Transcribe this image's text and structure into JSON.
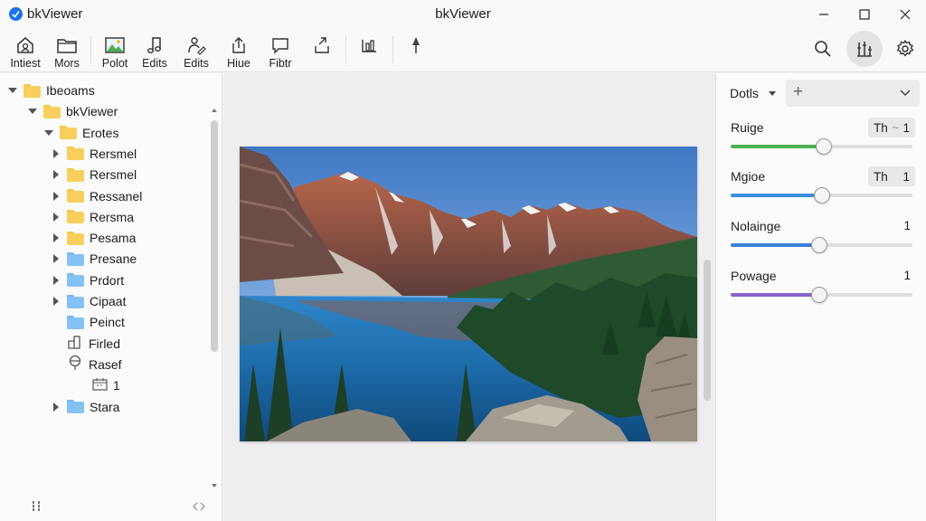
{
  "window": {
    "app_name": "bkViewer",
    "title": "bkViewer",
    "controls": [
      "minimize",
      "maximize",
      "close"
    ]
  },
  "toolbar": {
    "tools": [
      {
        "label": "Intiest",
        "icon": "home-icon"
      },
      {
        "label": "Mors",
        "icon": "folder-icon"
      },
      {
        "label": "Polot",
        "icon": "image-icon"
      },
      {
        "label": "Edits",
        "icon": "music-note-icon"
      },
      {
        "label": "Edits",
        "icon": "edit-person-icon"
      },
      {
        "label": "Hiue",
        "icon": "share-icon"
      },
      {
        "label": "Fibtr",
        "icon": "comment-icon"
      },
      {
        "label": "",
        "icon": "export-arrow-icon"
      },
      {
        "label": "",
        "icon": "bar-chart-icon"
      },
      {
        "label": "",
        "icon": "microphone-icon"
      }
    ],
    "right_tools": [
      "search-icon",
      "equalizer-icon",
      "settings-gear-icon"
    ]
  },
  "tree": [
    {
      "label": "Ibeoams",
      "level": 0,
      "expanded": true,
      "icon": "folder",
      "color": "yellow"
    },
    {
      "label": "bkViewer",
      "level": 1,
      "expanded": true,
      "icon": "folder",
      "color": "yellow"
    },
    {
      "label": "Erotes",
      "level": 2,
      "expanded": true,
      "icon": "folder",
      "color": "yellow"
    },
    {
      "label": "Rersmel",
      "level": 3,
      "expanded": false,
      "icon": "folder",
      "color": "yellow"
    },
    {
      "label": "Rersmel",
      "level": 3,
      "expanded": false,
      "icon": "folder",
      "color": "yellow"
    },
    {
      "label": "Ressanel",
      "level": 3,
      "expanded": false,
      "icon": "folder",
      "color": "yellow"
    },
    {
      "label": "Rersma",
      "level": 3,
      "expanded": false,
      "icon": "folder",
      "color": "yellow"
    },
    {
      "label": "Pesama",
      "level": 3,
      "expanded": false,
      "icon": "folder",
      "color": "yellow"
    },
    {
      "label": "Presane",
      "level": 3,
      "expanded": false,
      "icon": "folder",
      "color": "blue"
    },
    {
      "label": "Prdort",
      "level": 3,
      "expanded": false,
      "icon": "folder",
      "color": "blue"
    },
    {
      "label": "Cipaat",
      "level": 3,
      "expanded": false,
      "icon": "folder",
      "color": "blue"
    },
    {
      "label": "Peinct",
      "level": 3,
      "expanded": null,
      "icon": "folder",
      "color": "blue"
    },
    {
      "label": "Firled",
      "level": 3,
      "expanded": null,
      "icon": "file-split",
      "color": ""
    },
    {
      "label": "Rasef",
      "level": 3,
      "expanded": null,
      "icon": "pin",
      "color": ""
    },
    {
      "label": "1",
      "level": 4,
      "expanded": null,
      "icon": "calendar",
      "color": ""
    },
    {
      "label": "Stara",
      "level": 3,
      "expanded": false,
      "icon": "folder",
      "color": "blue"
    }
  ],
  "adjustments": {
    "dropdown_label": "Dotls",
    "add_symbol": "+",
    "sliders": [
      {
        "label": "Ruige",
        "value_prefix": "Th",
        "value_sep": "~",
        "value": "1",
        "boxed": true,
        "level": 0.51,
        "color": "#4caf50"
      },
      {
        "label": "Mgioe",
        "value_prefix": "Th",
        "value_sep": "",
        "value": "1",
        "boxed": true,
        "level": 0.5,
        "color": "#3b8fe0"
      },
      {
        "label": "Nolainge",
        "value_prefix": "",
        "value_sep": "",
        "value": "1",
        "boxed": false,
        "level": 0.49,
        "color": "#3b7fd6"
      },
      {
        "label": "Powage",
        "value_prefix": "",
        "value_sep": "",
        "value": "1",
        "boxed": false,
        "level": 0.49,
        "color": "#8a63d2"
      }
    ]
  },
  "footer": {
    "handle_icon": "drag-handle-icon",
    "arrows_icon": "collapse-arrows-icon"
  }
}
